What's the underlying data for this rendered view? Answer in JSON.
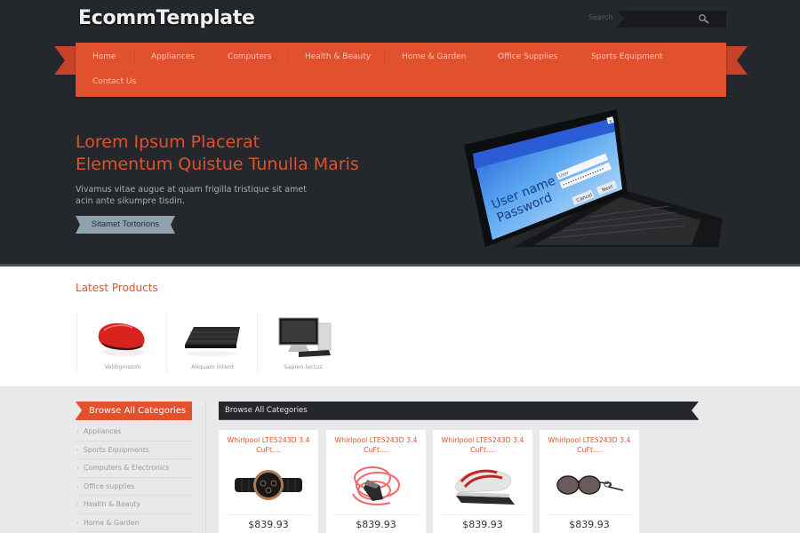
{
  "header": {
    "logo": "EcommTemplate",
    "search_label": "Search",
    "search_value": ""
  },
  "nav": {
    "items": [
      {
        "label": "Home"
      },
      {
        "label": "Appliances"
      },
      {
        "label": "Computers"
      },
      {
        "label": "Health & Beauty"
      },
      {
        "label": "Home & Garden"
      },
      {
        "label": "Office Supplies"
      },
      {
        "label": "Sports Equipment"
      },
      {
        "label": "Contact Us"
      }
    ]
  },
  "hero": {
    "title_line1": "Lorem Ipsum Placerat",
    "title_line2": "Elementum Quistue Tunulla Maris",
    "text": "Vivamus vitae augue at quam frigilla tristique sit amet acin ante sikumpre tisdin.",
    "button_label": "Sitamet Tortorions",
    "image": {
      "icon": "laptop-login-image",
      "screen_field1_label": "User name",
      "screen_field2_label": "Password",
      "screen_user_value": "User",
      "screen_cancel": "Cancel",
      "screen_next": "Next",
      "screen_close": "x"
    }
  },
  "latest": {
    "title": "Latest Products",
    "items": [
      {
        "label": "Veldignissim",
        "icon": "mouse-image"
      },
      {
        "label": "Aliquam interd",
        "icon": "keyboard-image"
      },
      {
        "label": "Sapien lectus",
        "icon": "desktop-computer-image"
      }
    ]
  },
  "sidebar": {
    "heading": "Browse All Categories",
    "items": [
      {
        "label": "Appliances"
      },
      {
        "label": "Sports Equipments"
      },
      {
        "label": "Computers & Electronics"
      },
      {
        "label": "Office supplies"
      },
      {
        "label": "Health & Beauty"
      },
      {
        "label": "Home & Garden"
      }
    ]
  },
  "catalog": {
    "heading": "Browse All Categories",
    "products": [
      {
        "name": "Whirlpool LTE5243D 3.4 CuFt....",
        "price": "$839.93",
        "icon": "watch-image"
      },
      {
        "name": "Whirlpool LTE5243D 3.4 CuFt....",
        "price": "$839.93",
        "icon": "headphones-image"
      },
      {
        "name": "Whirlpool LTE5243D 3.4 CuFt....",
        "price": "$839.93",
        "icon": "stapler-image"
      },
      {
        "name": "Whirlpool LTE5243D 3.4 CuFt....",
        "price": "$839.93",
        "icon": "sunglasses-image"
      }
    ]
  },
  "colors": {
    "accent": "#e2512d",
    "dark": "#24272b",
    "page_bg": "#e9e9e9",
    "button": "#8ea3ab"
  }
}
